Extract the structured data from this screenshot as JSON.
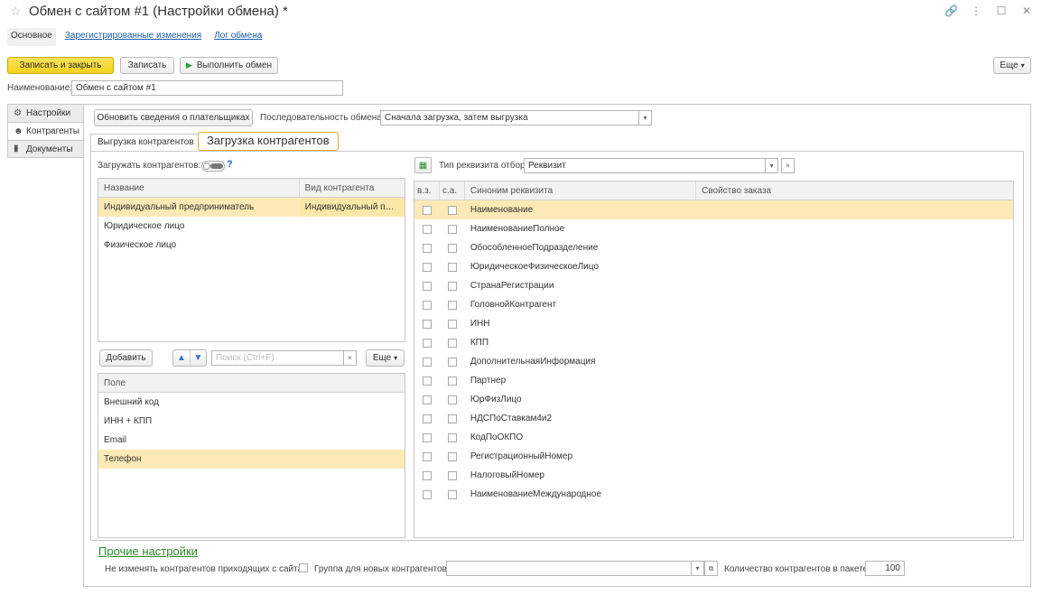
{
  "window": {
    "title": "Обмен с сайтом #1 (Настройки обмена) *"
  },
  "nav": {
    "tabs": [
      {
        "label": "Основное"
      },
      {
        "label": "Зарегистрированные изменения"
      },
      {
        "label": "Лог обмена"
      }
    ]
  },
  "toolbar": {
    "save_close": "Записать и закрыть",
    "save": "Записать",
    "run": "Выполнить обмен",
    "more": "Еще"
  },
  "name_field": {
    "label": "Наименование:",
    "value": "Обмен с сайтом #1"
  },
  "side_tabs": [
    {
      "label": "Настройки",
      "icon": "gear-icon"
    },
    {
      "label": "Контрагенты",
      "icon": "people-icon"
    },
    {
      "label": "Документы",
      "icon": "document-icon"
    }
  ],
  "contractors": {
    "update_btn": "Обновить сведения о плательщиках",
    "sequence_label": "Последовательность обмена:",
    "sequence_value": "Сначала загрузка, затем выгрузка",
    "subtabs": [
      "Выгрузка контрагентов",
      "Загрузка контрагентов"
    ],
    "tooltip": "Загрузка контрагентов",
    "load_label": "Загружать контрагентов:",
    "help": "?",
    "types_table": {
      "headers": [
        "Название",
        "Вид контрагента"
      ],
      "rows": [
        [
          "Индивидуальный предприниматель",
          "Индивидуальный предприниматель"
        ],
        [
          "Юридическое лицо",
          ""
        ],
        [
          "Физическое лицо",
          ""
        ]
      ]
    },
    "add_btn": "Добавить",
    "search_placeholder": "Поиск (Ctrl+F)",
    "clear": "×",
    "more": "Еще",
    "fields_table": {
      "header": "Поле",
      "rows": [
        "Внешний код",
        "ИНН + КПП",
        "Email",
        "Телефон"
      ]
    },
    "filter_label": "Тип реквизита отбор:",
    "filter_value": "Реквизит",
    "attrs_table": {
      "headers": [
        "в.з.",
        "с.а.",
        "Синоним реквизита",
        "Свойство заказа"
      ],
      "rows": [
        "Наименование",
        "НаименованиеПолное",
        "ОбособленноеПодразделение",
        "ЮридическоеФизическоеЛицо",
        "СтранаРегистрации",
        "ГоловнойКонтрагент",
        "ИНН",
        "КПП",
        "ДополнительнаяИнформация",
        "Партнер",
        "ЮрФизЛицо",
        "НДСПоСтавкам4и2",
        "КодПоОКПО",
        "РегистрационныйНомер",
        "НалоговыйНомер",
        "НаименованиеМеждународное"
      ]
    },
    "other_settings": "Прочие настройки",
    "no_change_label": "Не изменять контрагентов приходящих с сайта:",
    "group_label": "Группа для новых контрагентов:",
    "count_label": "Количество контрагентов в пакете:",
    "count_value": "100"
  }
}
